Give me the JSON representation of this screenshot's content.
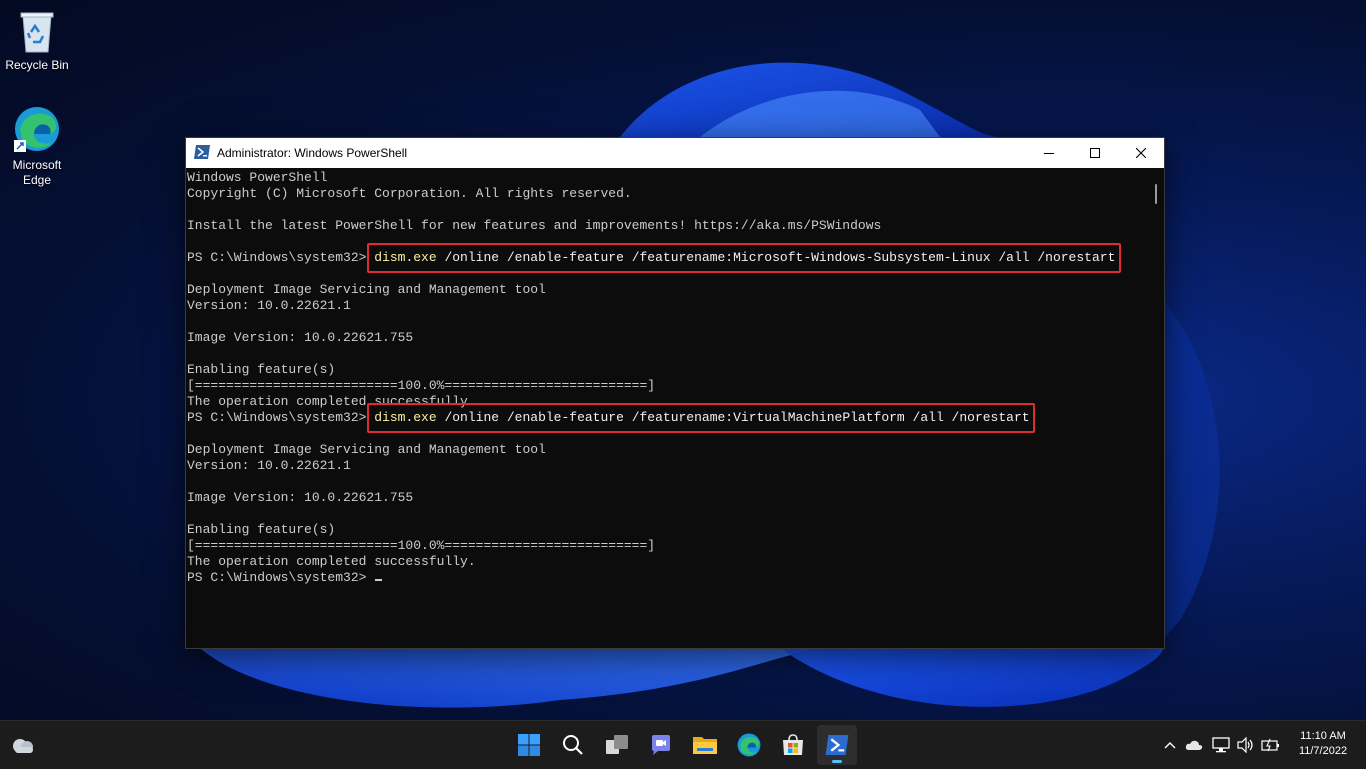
{
  "desktop": {
    "icons": [
      {
        "label": "Recycle Bin",
        "icon": "recycle-bin-icon"
      },
      {
        "label": "Microsoft Edge",
        "icon": "edge-icon"
      }
    ]
  },
  "window": {
    "title": "Administrator: Windows PowerShell",
    "controls": {
      "minimize": "minimize-icon",
      "maximize": "maximize-icon",
      "close": "close-icon"
    }
  },
  "console": {
    "lines": [
      {
        "text": "Windows PowerShell"
      },
      {
        "text": "Copyright (C) Microsoft Corporation. All rights reserved."
      },
      {
        "text": ""
      },
      {
        "text": "Install the latest PowerShell for new features and improvements! https://aka.ms/PSWindows"
      },
      {
        "text": ""
      },
      {
        "prompt": "PS C:\\Windows\\system32> ",
        "exe": "dism.exe",
        "args": " /online /enable-feature /featurename:Microsoft-Windows-Subsystem-Linux /all /norestart"
      },
      {
        "text": ""
      },
      {
        "text": "Deployment Image Servicing and Management tool"
      },
      {
        "text": "Version: 10.0.22621.1"
      },
      {
        "text": ""
      },
      {
        "text": "Image Version: 10.0.22621.755"
      },
      {
        "text": ""
      },
      {
        "text": "Enabling feature(s)"
      },
      {
        "text": "[==========================100.0%==========================]"
      },
      {
        "text": "The operation completed successfully."
      },
      {
        "prompt": "PS C:\\Windows\\system32> ",
        "exe": "dism.exe",
        "args": " /online /enable-feature /featurename:VirtualMachinePlatform /all /norestart"
      },
      {
        "text": ""
      },
      {
        "text": "Deployment Image Servicing and Management tool"
      },
      {
        "text": "Version: 10.0.22621.1"
      },
      {
        "text": ""
      },
      {
        "text": "Image Version: 10.0.22621.755"
      },
      {
        "text": ""
      },
      {
        "text": "Enabling feature(s)"
      },
      {
        "text": "[==========================100.0%==========================]"
      },
      {
        "text": "The operation completed successfully."
      },
      {
        "prompt": "PS C:\\Windows\\system32> ",
        "cursor": true
      }
    ],
    "highlight_color": "#e02c2c"
  },
  "taskbar": {
    "apps": [
      "start-icon",
      "search-icon",
      "task-view-icon",
      "chat-icon",
      "file-explorer-icon",
      "edge-icon",
      "store-icon",
      "powershell-icon"
    ],
    "active_app": "powershell-icon",
    "accent": "#4cc2ff",
    "tray": [
      "chevron-up-icon",
      "onedrive-icon",
      "network-icon",
      "volume-icon",
      "battery-icon"
    ],
    "weather_icon": "weather-cloud-icon",
    "time": "11:10 AM",
    "date": "11/7/2022"
  }
}
